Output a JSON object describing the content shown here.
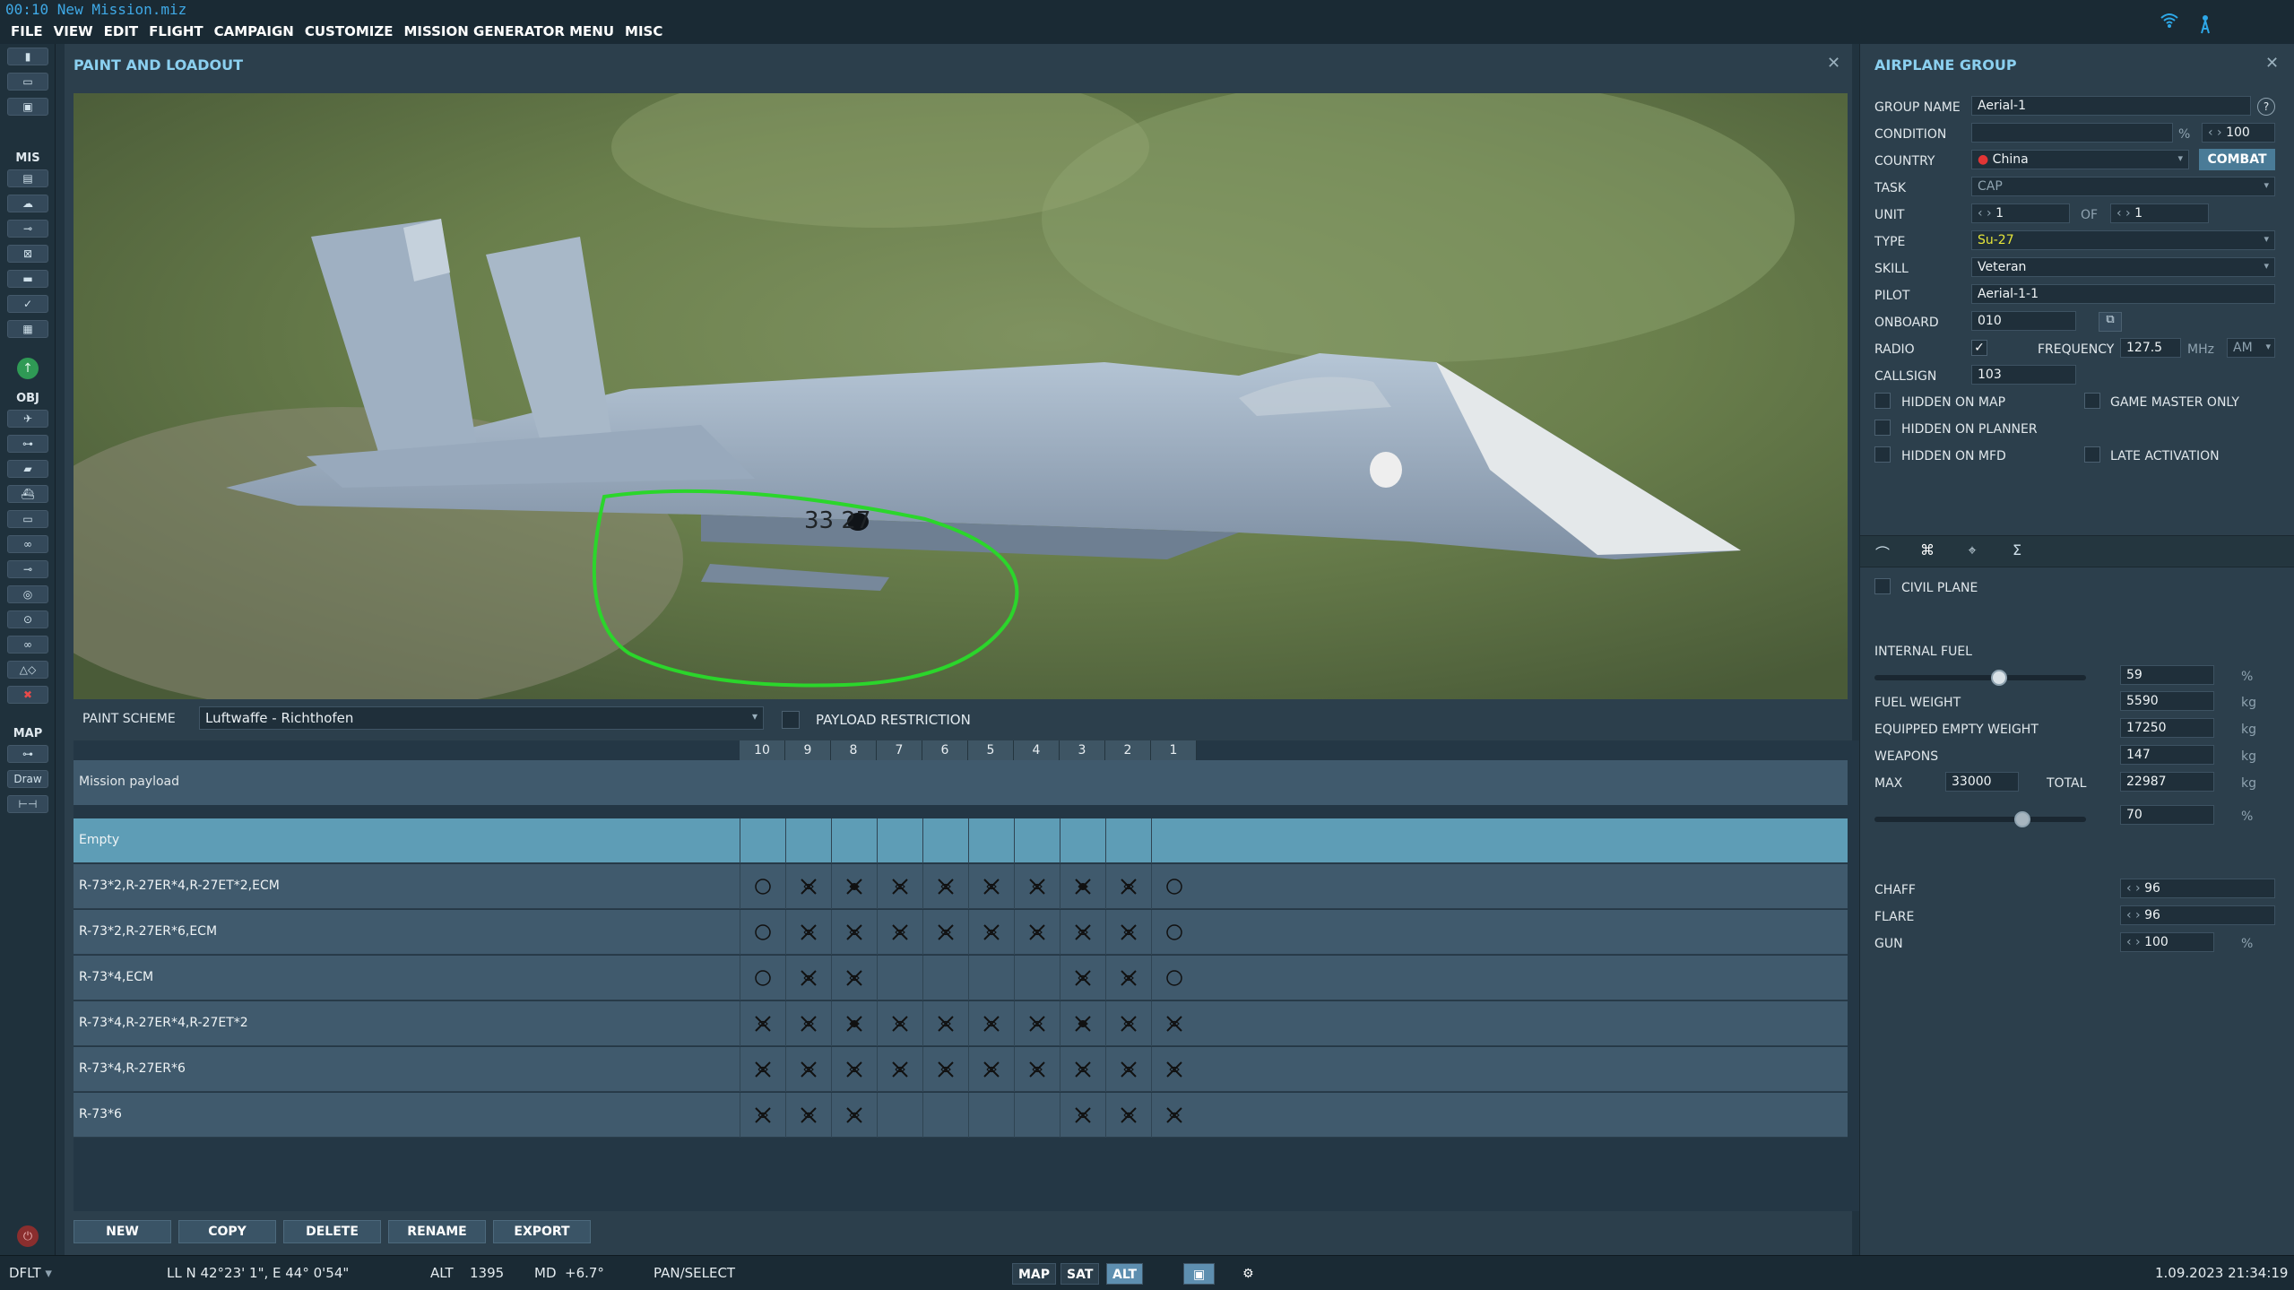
{
  "window": {
    "title": "00:10 New Mission.miz"
  },
  "menu": [
    "FILE",
    "VIEW",
    "EDIT",
    "FLIGHT",
    "CAMPAIGN",
    "CUSTOMIZE",
    "MISSION GENERATOR MENU",
    "MISC"
  ],
  "left_toolbar": {
    "mis_label": "MIS",
    "obj_label": "OBJ",
    "map_label": "MAP",
    "draw_label": "Draw"
  },
  "paint": {
    "title": "PAINT AND LOADOUT",
    "scheme_label": "PAINT SCHEME",
    "scheme_value": "Luftwaffe - Richthofen",
    "payload_restriction_label": "PAYLOAD RESTRICTION",
    "aircraft_marking": "33 27",
    "station_headers": [
      "10",
      "9",
      "8",
      "7",
      "6",
      "5",
      "4",
      "3",
      "2",
      "1"
    ],
    "mission_payload": "Mission payload",
    "loadouts": [
      {
        "name": "Empty",
        "selected": true,
        "stations": [
          "",
          "",
          "",
          "",
          "",
          "",
          "",
          "",
          "",
          ""
        ]
      },
      {
        "name": "R-73*2,R-27ER*4,R-27ET*2,ECM",
        "selected": false,
        "stations": [
          "o",
          "x",
          "xb",
          "x",
          "x",
          "x",
          "x",
          "xb",
          "x",
          "o"
        ]
      },
      {
        "name": "R-73*2,R-27ER*6,ECM",
        "selected": false,
        "stations": [
          "o",
          "x",
          "x",
          "x",
          "x",
          "x",
          "x",
          "x",
          "x",
          "o"
        ]
      },
      {
        "name": "R-73*4,ECM",
        "selected": false,
        "stations": [
          "o",
          "x",
          "x",
          "",
          "",
          "",
          "",
          "x",
          "x",
          "o"
        ]
      },
      {
        "name": "R-73*4,R-27ER*4,R-27ET*2",
        "selected": false,
        "stations": [
          "x",
          "x",
          "xb",
          "x",
          "x",
          "x",
          "x",
          "xb",
          "x",
          "x"
        ]
      },
      {
        "name": "R-73*4,R-27ER*6",
        "selected": false,
        "stations": [
          "x",
          "x",
          "x",
          "x",
          "x",
          "x",
          "x",
          "x",
          "x",
          "x"
        ]
      },
      {
        "name": "R-73*6",
        "selected": false,
        "stations": [
          "x",
          "x",
          "x",
          "",
          "",
          "",
          "",
          "x",
          "x",
          "x"
        ]
      }
    ],
    "buttons": {
      "new": "NEW",
      "copy": "COPY",
      "delete": "DELETE",
      "rename": "RENAME",
      "export": "EXPORT"
    }
  },
  "group": {
    "title": "AIRPLANE GROUP",
    "labels": {
      "group_name": "GROUP NAME",
      "condition": "CONDITION",
      "country": "COUNTRY",
      "task": "TASK",
      "unit": "UNIT",
      "of": "OF",
      "type": "TYPE",
      "skill": "SKILL",
      "pilot": "PILOT",
      "onboard": "ONBOARD",
      "radio": "RADIO",
      "frequency": "FREQUENCY",
      "callsign": "CALLSIGN",
      "hidden_map": "HIDDEN ON MAP",
      "game_master": "GAME MASTER ONLY",
      "hidden_planner": "HIDDEN ON PLANNER",
      "hidden_mfd": "HIDDEN ON MFD",
      "late_activation": "LATE ACTIVATION",
      "civil_plane": "CIVIL PLANE",
      "internal_fuel": "INTERNAL FUEL",
      "fuel_weight": "FUEL WEIGHT",
      "empty_weight": "EQUIPPED EMPTY WEIGHT",
      "weapons": "WEAPONS",
      "max": "MAX",
      "total": "TOTAL",
      "chaff": "CHAFF",
      "flare": "FLARE",
      "gun": "GUN"
    },
    "values": {
      "group_name": "Aerial-1",
      "condition": "100",
      "country": "China",
      "combat": "COMBAT",
      "task": "CAP",
      "unit": "1",
      "of": "1",
      "type": "Su-27",
      "skill": "Veteran",
      "pilot": "Aerial-1-1",
      "onboard": "010",
      "frequency": "127.5",
      "freq_unit": "MHz",
      "modulation": "AM",
      "callsign": "103",
      "internal_fuel": "59",
      "fuel_weight": "5590",
      "empty_weight": "17250",
      "weapons": "147",
      "max": "33000",
      "total": "22987",
      "total_pct": "70",
      "chaff": "96",
      "flare": "96",
      "gun": "100",
      "kg": "kg",
      "pct": "%",
      "help": "?"
    },
    "fuel_level": 0.59,
    "total_level": 0.7,
    "radio_checked": true
  },
  "status": {
    "profile": "DFLT",
    "coords": "LL  N 42°23' 1\", E 44° 0'54\"",
    "alt_label": "ALT",
    "alt": "1395",
    "md_label": "MD",
    "md": "+6.7°",
    "mode": "PAN/SELECT",
    "map": "MAP",
    "sat": "SAT",
    "alt_btn": "ALT",
    "datetime": "1.09.2023 21:34:19"
  }
}
